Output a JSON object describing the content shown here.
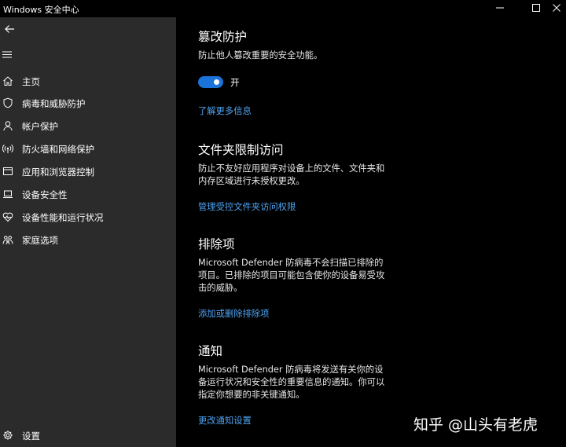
{
  "window": {
    "title": "Windows 安全中心"
  },
  "sidebar": {
    "items": [
      {
        "label": "主页",
        "icon": "home-icon"
      },
      {
        "label": "病毒和威胁防护",
        "icon": "shield-icon"
      },
      {
        "label": "帐户保护",
        "icon": "person-icon"
      },
      {
        "label": "防火墙和网络保护",
        "icon": "wifi-antenna-icon"
      },
      {
        "label": "应用和浏览器控制",
        "icon": "app-window-icon"
      },
      {
        "label": "设备安全性",
        "icon": "laptop-icon"
      },
      {
        "label": "设备性能和运行状况",
        "icon": "heart-icon"
      },
      {
        "label": "家庭选项",
        "icon": "family-icon"
      }
    ],
    "settings_label": "设置"
  },
  "main": {
    "tamper": {
      "title": "篡改防护",
      "desc": "防止他人篡改重要的安全功能。",
      "toggle_on": true,
      "toggle_label": "开",
      "link": "了解更多信息"
    },
    "folder": {
      "title": "文件夹限制访问",
      "desc": "防止不友好应用程序对设备上的文件、文件夹和内存区域进行未授权更改。",
      "link": "管理受控文件夹访问权限"
    },
    "exclusions": {
      "title": "排除项",
      "desc": "Microsoft Defender 防病毒不会扫描已排除的项目。已排除的项目可能包含使你的设备易受攻击的威胁。",
      "link": "添加或删除排除项"
    },
    "notifications": {
      "title": "通知",
      "desc": "Microsoft Defender 防病毒将发送有关你的设备运行状况和安全性的重要信息的通知。你可以指定你想要的非关键通知。",
      "link": "更改通知设置"
    }
  },
  "watermark": "知乎 @山头有老虎",
  "colors": {
    "sidebar_bg": "#2b2b2b",
    "main_bg": "#000000",
    "accent": "#1a73d9",
    "link": "#4ea3f2"
  }
}
